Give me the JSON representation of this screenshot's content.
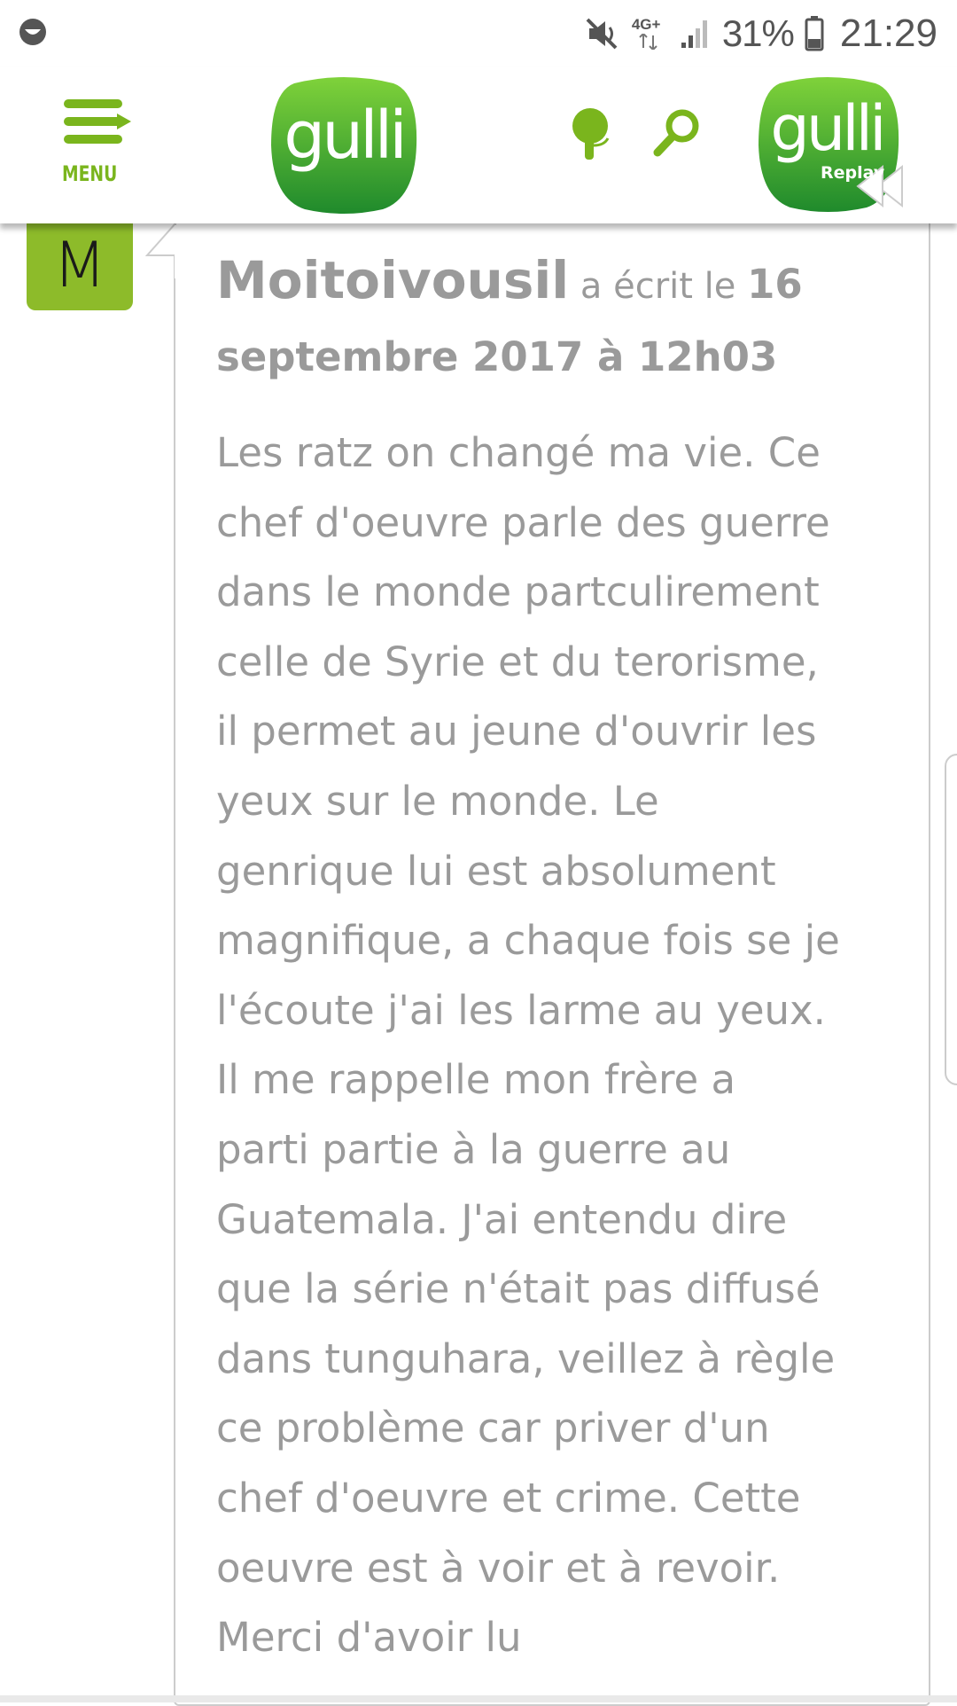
{
  "status_bar": {
    "left_icon": "notification-icon",
    "icons": [
      "mute-icon",
      "network-4g-icon",
      "signal-icon"
    ],
    "network_label": "4G+",
    "battery_percent": "31%",
    "battery_icon": "battery-icon",
    "time": "21:29"
  },
  "header": {
    "menu_label": "MENU",
    "logo_text": "gulli",
    "tree_icon": "tree-icon",
    "search_icon": "search-icon",
    "replay_logo_text": "gulli",
    "replay_label": "Replay",
    "brand_color": "#7ab51d"
  },
  "comment": {
    "avatar_letter": "M",
    "author": "Moitoivousil",
    "wrote_on": "a écrit le",
    "date_part1": "16",
    "date_part2": "septembre 2017 à 12h03",
    "body_lines": [
      "Les ratz on changé ma vie. Ce",
      "chef d'oeuvre parle des guerre",
      "dans le monde partculirement",
      "celle de Syrie et du terorisme,",
      "il permet au jeune d'ouvrir les",
      "yeux sur le monde. Le",
      "genrique lui est absolument",
      "magnifique, a chaque fois se je",
      "l'écoute j'ai les larme au yeux.",
      "Il me rappelle mon frère a",
      "parti partie à la guerre au",
      "Guatemala. J'ai entendu dire",
      "que la série n'était pas diffusé",
      "dans tunguhara, veillez à règle",
      "ce problème car priver d'un",
      "chef d'oeuvre et crime. Cette",
      "oeuvre est à voir et à revoir.",
      "Merci d'avoir lu"
    ]
  }
}
